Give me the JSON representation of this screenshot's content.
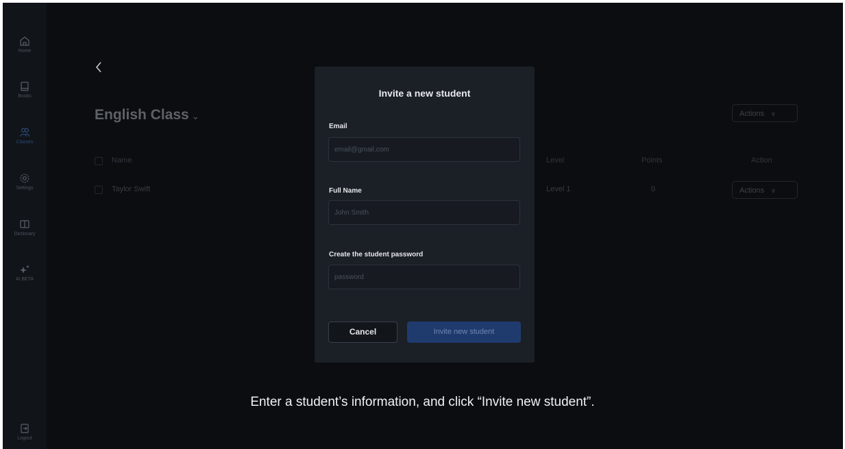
{
  "sidebar": {
    "items": [
      {
        "label": "Home",
        "icon": "home-icon"
      },
      {
        "label": "Books",
        "icon": "book-icon"
      },
      {
        "label": "Classes",
        "icon": "users-icon",
        "active": true
      },
      {
        "label": "Settings",
        "icon": "gear-icon"
      },
      {
        "label": "Dictionary",
        "icon": "open-book-icon"
      },
      {
        "label": "AI BETA",
        "icon": "sparkle-icon"
      }
    ],
    "logout_label": "Logout"
  },
  "header": {
    "back_icon": "chevron-left-icon",
    "class_title": "English Class",
    "title_chevron": "⌄",
    "actions_label": "Actions"
  },
  "table": {
    "columns": [
      "Name",
      "Level",
      "Points",
      "Action"
    ],
    "rows": [
      {
        "name": "Taylor Swift",
        "level": "Level 1",
        "points": "0",
        "action": "Actions"
      }
    ]
  },
  "modal": {
    "title": "Invite a new student",
    "email_label": "Email",
    "email_placeholder": "email@gmail.com",
    "fullname_label": "Full Name",
    "fullname_placeholder": "John Smith",
    "password_label": "Create the student password",
    "password_placeholder": "password",
    "cancel_label": "Cancel",
    "invite_label": "Invite new student"
  },
  "caption": "Enter a student’s information, and click “Invite new student”.",
  "colors": {
    "background": "#0b0d10",
    "sidebar": "#111419",
    "modal": "#1b1f26",
    "accent": "#1f3b6e"
  }
}
